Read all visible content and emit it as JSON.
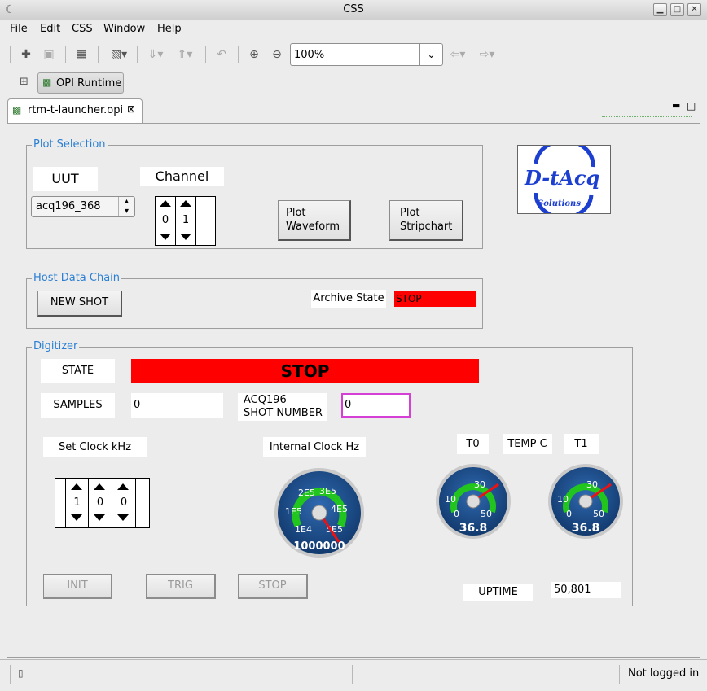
{
  "window": {
    "title": "CSS"
  },
  "menu": [
    "File",
    "Edit",
    "CSS",
    "Window",
    "Help"
  ],
  "toolbar": {
    "zoom_value": "100%"
  },
  "perspective": {
    "label": "OPI Runtime"
  },
  "editor_tab": {
    "title": "rtm-t-launcher.opi"
  },
  "logo": {
    "text": "D-tAcq",
    "subtext": "Solutions"
  },
  "plot_selection": {
    "label": "Plot Selection",
    "uut_label": "UUT",
    "uut_value": "acq196_368",
    "channel_label": "Channel",
    "channel_digits": [
      "0",
      "1"
    ],
    "plot_waveform_line1": "Plot",
    "plot_waveform_line2": "Waveform",
    "plot_stripchart_line1": "Plot",
    "plot_stripchart_line2": "Stripchart"
  },
  "host_data_chain": {
    "label": "Host Data Chain",
    "new_shot": "NEW SHOT",
    "archive_state_label": "Archive State",
    "archive_state_value": "STOP"
  },
  "digitizer": {
    "label": "Digitizer",
    "state_label": "STATE",
    "state_value": "STOP",
    "samples_label": "SAMPLES",
    "samples_value": "0",
    "acq_line1": "ACQ196",
    "acq_line2": "SHOT NUMBER",
    "shot_number_value": "0",
    "set_clock_label": "Set Clock kHz",
    "clock_digits": [
      "1",
      "0",
      "0"
    ],
    "internal_clock_label": "Internal Clock Hz",
    "internal_clock_value": "1000000",
    "internal_clock_fraction": 0.88,
    "gauge_ticks": [
      "1E4",
      "1E5",
      "2E5",
      "3E5",
      "4E5",
      "5E5"
    ],
    "t0_label": "T0",
    "temp_label": "TEMP C",
    "t1_label": "T1",
    "t0_value": "36.8",
    "t1_value": "36.8",
    "temp_ticks": [
      "0",
      "10",
      "30",
      "50"
    ],
    "init": "INIT",
    "trig": "TRIG",
    "stop": "STOP",
    "uptime_label": "UPTIME",
    "uptime_value": "50,801"
  },
  "status": {
    "login": "Not logged in"
  },
  "colors": {
    "alarm_red": "#ff0000",
    "group_label_blue": "#2a7fd4",
    "gauge_blue": "#1d4a86",
    "gauge_green": "#22c41e",
    "shot_border": "#d63fd6"
  }
}
